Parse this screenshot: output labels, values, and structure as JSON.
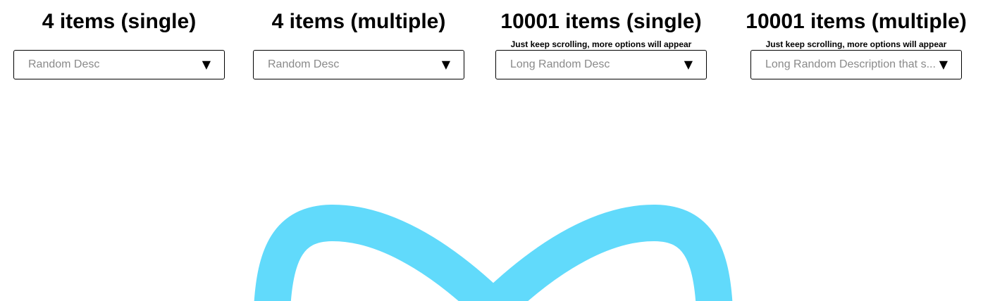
{
  "columns": [
    {
      "title": "4 items (single)",
      "hint": "",
      "select": {
        "value": "Random Desc",
        "arrow": "▼"
      }
    },
    {
      "title": "4 items (multiple)",
      "hint": "",
      "select": {
        "value": "Random Desc",
        "arrow": "▼"
      }
    },
    {
      "title": "10001 items (single)",
      "hint": "Just keep scrolling, more options will appear",
      "select": {
        "value": "Long Random Desc",
        "arrow": "▼"
      }
    },
    {
      "title": "10001 items (multiple)",
      "hint": "Just keep scrolling, more options will appear",
      "select": {
        "value": "Long Random Description that s...",
        "arrow": "▼"
      }
    }
  ],
  "colors": {
    "logo": "#61dafb",
    "placeholder_text": "#8a8a8a",
    "border": "#000000"
  },
  "icons": {
    "logo": "react-logo-icon",
    "dropdown": "triangle-down-icon"
  }
}
